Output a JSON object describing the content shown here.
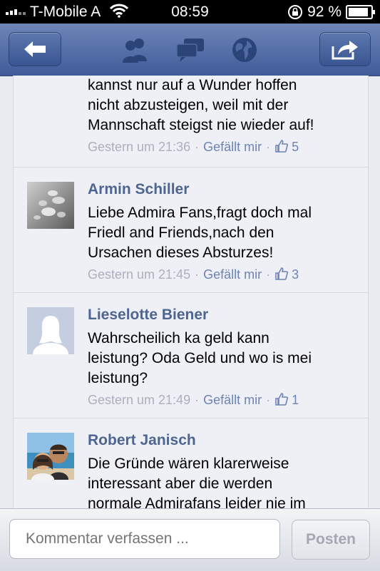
{
  "status_bar": {
    "carrier": "T-Mobile A",
    "time": "08:59",
    "battery": "92 %"
  },
  "nav": {
    "icons": [
      "back-arrow-icon",
      "friends-icon",
      "messages-icon",
      "globe-icon",
      "share-icon"
    ]
  },
  "comments": [
    {
      "name": "",
      "text_lines": [
        "kannst nur auf a Wunder hoffen",
        "nicht abzusteigen, weil mit der",
        "Mannschaft steigst nie wieder auf!"
      ],
      "timestamp": "Gestern um 21:36",
      "like_label": "Gefällt mir",
      "likes": "5"
    },
    {
      "name": "Armin Schiller",
      "text_lines": [
        "Liebe Admira Fans,fragt doch mal",
        "Friedl and Friends,nach den",
        "Ursachen dieses Absturzes!"
      ],
      "timestamp": "Gestern um 21:45",
      "like_label": "Gefällt mir",
      "likes": "3"
    },
    {
      "name": "Lieselotte Biener",
      "text_lines": [
        "Wahrscheilich ka geld kann",
        "leistung? Oda Geld und wo is mei",
        "leistung?"
      ],
      "timestamp": "Gestern um 21:49",
      "like_label": "Gefällt mir",
      "likes": "1"
    },
    {
      "name": "Robert Janisch",
      "text_lines": [
        "Die Gründe wären klarerweise",
        "interessant aber die werden",
        "normale Admirafans leider nie im"
      ],
      "timestamp": "",
      "like_label": "",
      "likes": ""
    }
  ],
  "composer": {
    "placeholder": "Kommentar verfassen ...",
    "post_label": "Posten"
  },
  "colors": {
    "nav_blue": "#3f5b99",
    "name_blue": "#4e6592",
    "link_blue": "#6d84b4"
  }
}
